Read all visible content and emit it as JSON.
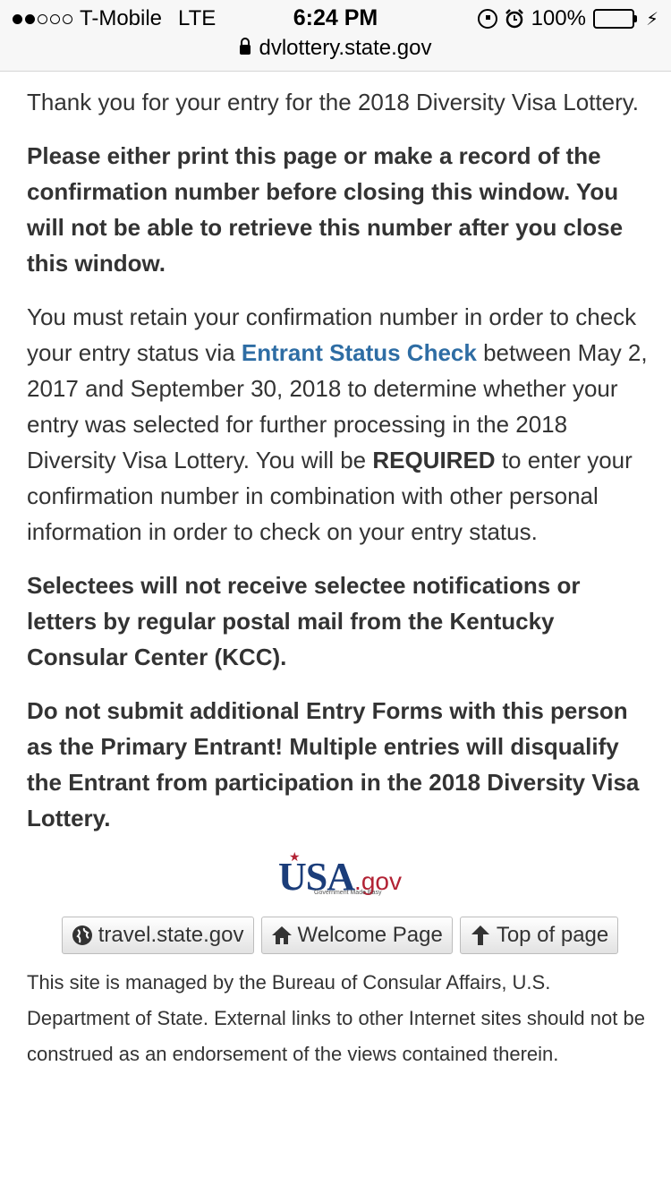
{
  "status_bar": {
    "carrier": "T-Mobile",
    "network": "LTE",
    "time": "6:24 PM",
    "battery": "100%",
    "battery_level": 1.0,
    "icons": [
      "orientation-lock-icon",
      "alarm-icon",
      "battery-icon",
      "charging-bolt-icon"
    ]
  },
  "browser": {
    "url": "dvlottery.state.gov"
  },
  "content": {
    "intro": "Thank you for your entry for the 2018 Diversity Visa Lottery.",
    "warning_print": "Please either print this page or make a record of the confirmation number before closing this window. You will not be able to retrieve this number after you close this window.",
    "retain_before_link": "You must retain your confirmation number in order to check your entry status via ",
    "status_link": "Entrant Status Check",
    "retain_after_link": " between May 2, 2017 and September 30, 2018 to determine whether your entry was selected for further processing in the 2018 Diversity Visa Lottery. You will be ",
    "required_word": "REQUIRED",
    "retain_end": " to enter your confirmation number in combination with other personal information in order to check on your entry status.",
    "selectees_notice": "Selectees will not receive selectee notifications or letters by regular postal mail from the Kentucky Consular Center (KCC).",
    "no_additional": "Do not submit additional Entry Forms with this person as the Primary Entrant! Multiple entries will disqualify the Entrant from participation in the 2018 Diversity Visa Lottery."
  },
  "logo": {
    "usa": "USA",
    "gov": ".gov",
    "tagline": "Government Made Easy"
  },
  "buttons": {
    "travel": "travel.state.gov",
    "welcome": "Welcome Page",
    "top": "Top of page"
  },
  "footer": {
    "text": "This site is managed by the Bureau of Consular Affairs, U.S. Department of State. External links to other Internet sites should not be construed as an endorsement of the views contained therein."
  }
}
